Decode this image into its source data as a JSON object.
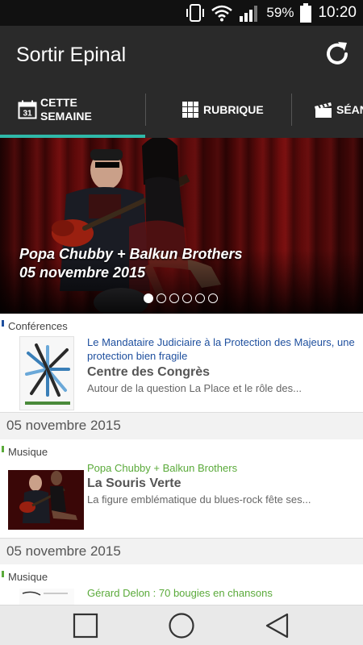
{
  "status_bar": {
    "battery": "59%",
    "time": "10:20",
    "icons": [
      "vibrate-icon",
      "wifi-icon",
      "signal-icon",
      "battery-icon"
    ]
  },
  "app_bar": {
    "title": "Sortir Epinal",
    "refresh_icon": "refresh-icon"
  },
  "tabs": [
    {
      "line1": "CETTE",
      "line2": "SEMAINE",
      "icon": "calendar-icon",
      "icon_text": "31",
      "selected": true
    },
    {
      "label": "RUBRIQUE",
      "icon": "grid-icon",
      "selected": false
    },
    {
      "label": "SÉAN",
      "icon": "clapperboard-icon",
      "selected": false
    }
  ],
  "carousel": {
    "title": "Popa Chubby + Balkun Brothers",
    "date": "05 novembre 2015",
    "page_count": 6,
    "active_page": 1
  },
  "events": [
    {
      "category": "Conférences",
      "category_color": "#1e4f9e",
      "headline": "Le Mandataire Judiciaire à la Protection des Majeurs, une protection bien fragile",
      "headline_color": "#1e4f9e",
      "venue": "Centre des Congrès",
      "description": "Autour de la question La Place et le rôle des...",
      "date": "05 novembre 2015"
    },
    {
      "category": "Musique",
      "category_color": "#5aaa3a",
      "headline": "Popa Chubby + Balkun Brothers",
      "headline_color": "#5aaa3a",
      "venue": "La Souris Verte",
      "description": "La figure emblématique du blues-rock fête ses...",
      "date": "05 novembre 2015"
    },
    {
      "category": "Musique",
      "category_color": "#5aaa3a",
      "headline": "Gérard Delon : 70 bougies en chansons",
      "headline_color": "#5aaa3a"
    }
  ],
  "nav_bar": {
    "buttons": [
      "recent-apps-icon",
      "home-icon",
      "back-icon"
    ]
  },
  "colors": {
    "tab_indicator": "#2fb8a8",
    "app_bar": "#2a2a2a",
    "status_bar": "#111111"
  }
}
